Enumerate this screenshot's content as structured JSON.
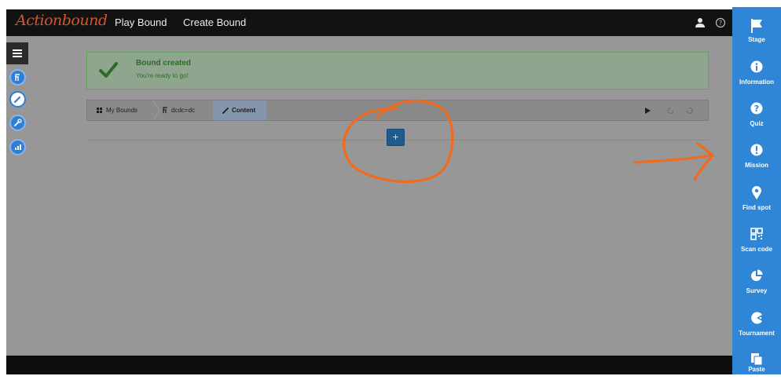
{
  "header": {
    "logo": "Actionbound",
    "nav": [
      "Play Bound",
      "Create Bound"
    ],
    "icons": [
      "user-icon",
      "help-icon"
    ]
  },
  "left_tools": [
    "menu-icon",
    "bound-icon",
    "pencil-icon",
    "wrench-icon",
    "chart-icon"
  ],
  "alert": {
    "title": "Bound created",
    "message": "You're ready to go!",
    "icon": "checkmark-icon",
    "color": "#5fa35b"
  },
  "breadcrumb": {
    "items": [
      {
        "label": "My Bounds",
        "icon": "grid-icon"
      },
      {
        "label": "dcdc=dc",
        "icon": "bound-icon"
      },
      {
        "label": "Content",
        "icon": "pencil-icon"
      }
    ],
    "controls": [
      "play-icon",
      "undo-icon",
      "redo-icon"
    ]
  },
  "add_button": {
    "label": "+"
  },
  "palette": {
    "color": "#2f86d6",
    "items": [
      {
        "label": "Stage",
        "icon": "flag-icon"
      },
      {
        "label": "Information",
        "icon": "info-icon"
      },
      {
        "label": "Quiz",
        "icon": "question-icon"
      },
      {
        "label": "Mission",
        "icon": "exclamation-icon"
      },
      {
        "label": "Find spot",
        "icon": "map-pin-icon"
      },
      {
        "label": "Scan code",
        "icon": "qr-code-icon"
      },
      {
        "label": "Survey",
        "icon": "pie-chart-icon"
      },
      {
        "label": "Tournament",
        "icon": "tournament-icon"
      },
      {
        "label": "Paste",
        "icon": "paste-icon"
      }
    ]
  },
  "annotation_color": "#f26a1b"
}
